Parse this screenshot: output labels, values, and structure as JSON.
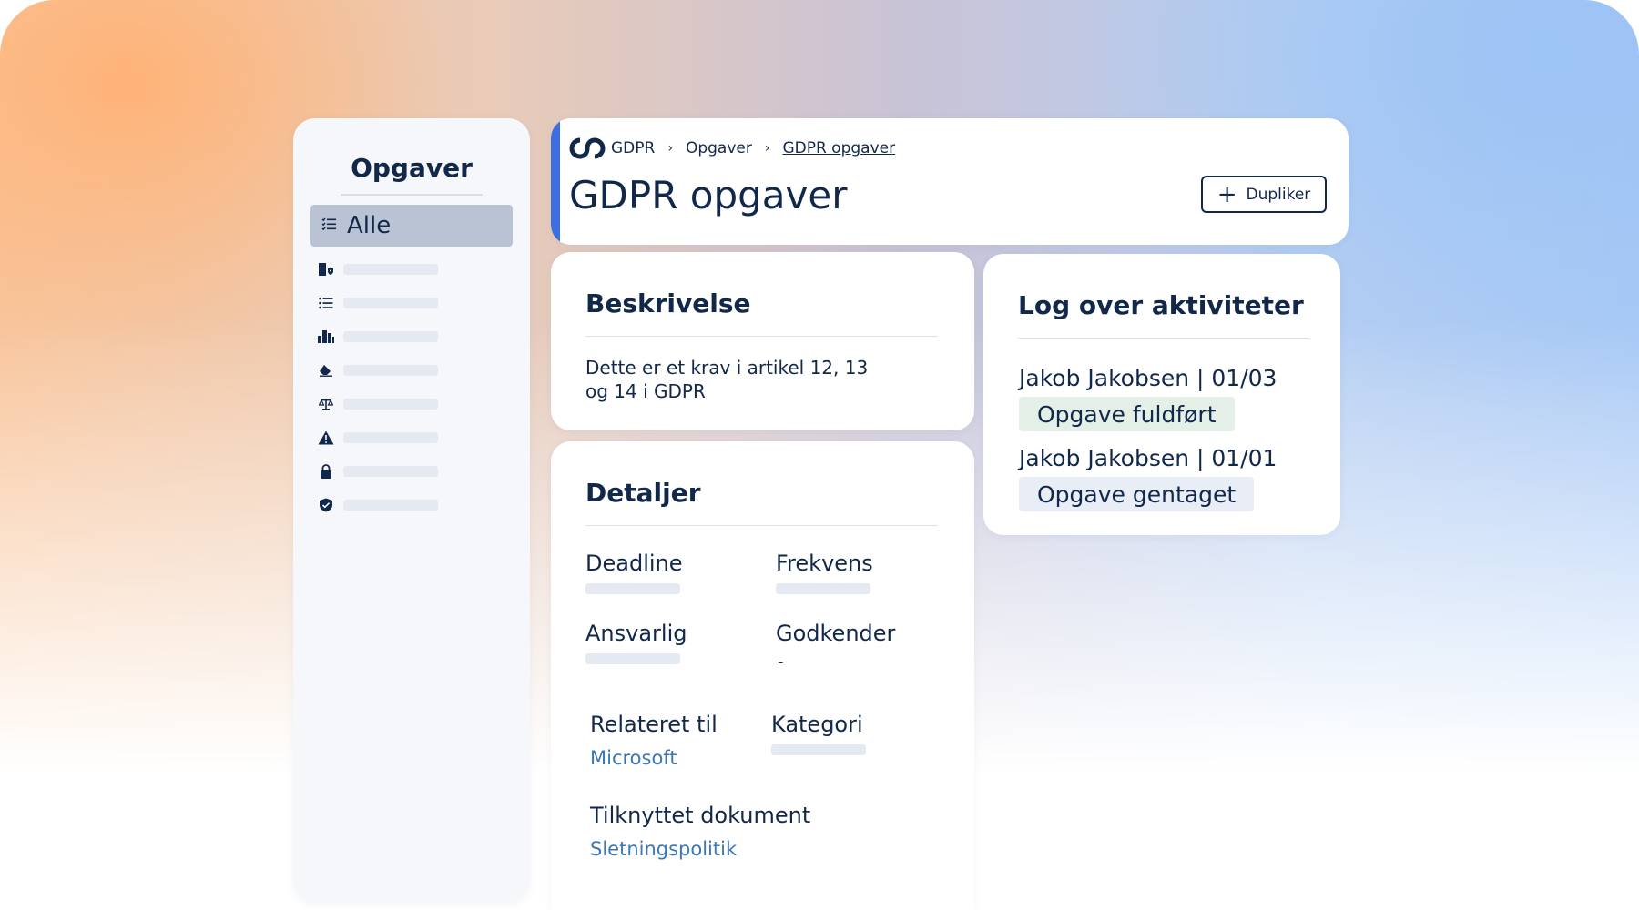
{
  "colors": {
    "accent": "#3d6ee0",
    "navy": "#12284a",
    "link": "#3d78b5",
    "tag_done": "#e4f0e7",
    "tag_repeat": "#e8edf6"
  },
  "sidebar": {
    "title": "Opgaver",
    "active": {
      "label": "Alle",
      "icon": "list-check-icon"
    },
    "items": [
      {
        "icon": "building-shield-icon"
      },
      {
        "icon": "list-icon"
      },
      {
        "icon": "buildings-icon"
      },
      {
        "icon": "eraser-icon"
      },
      {
        "icon": "scale-icon"
      },
      {
        "icon": "warning-icon"
      },
      {
        "icon": "lock-icon"
      },
      {
        "icon": "shield-check-icon"
      }
    ]
  },
  "header": {
    "breadcrumb": [
      "GDPR",
      "Opgaver",
      "GDPR opgaver"
    ],
    "title": "GDPR opgaver",
    "duplicate_label": "Dupliker"
  },
  "description": {
    "title": "Beskrivelse",
    "text": "Dette er et krav i artikel 12, 13 og 14 i GDPR"
  },
  "details": {
    "title": "Detaljer",
    "deadline_label": "Deadline",
    "frequency_label": "Frekvens",
    "responsible_label": "Ansvarlig",
    "approver_label": "Godkender",
    "approver_value": "-",
    "related_label": "Relateret til",
    "related_value": "Microsoft",
    "category_label": "Kategori",
    "document_label": "Tilknyttet dokument",
    "document_value": "Sletningspolitik"
  },
  "log": {
    "title": "Log over aktiviteter",
    "entries": [
      {
        "meta": "Jakob Jakobsen | 01/03",
        "status": "Opgave fuldført"
      },
      {
        "meta": "Jakob Jakobsen | 01/01",
        "status": "Opgave gentaget"
      }
    ]
  }
}
